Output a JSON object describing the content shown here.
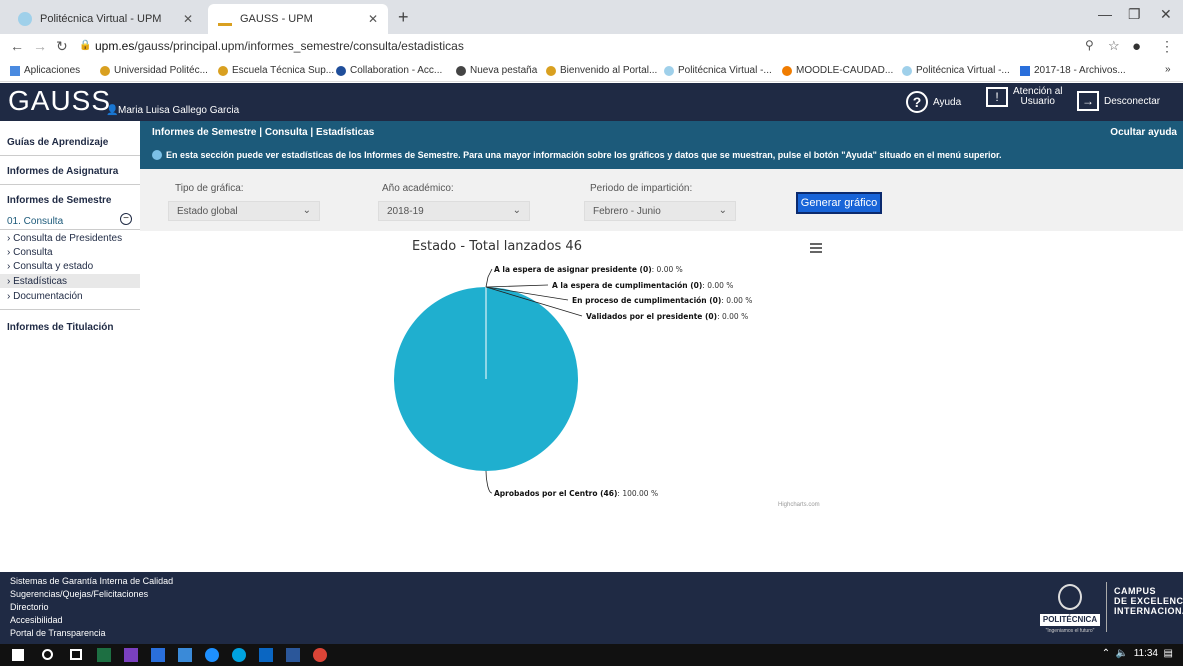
{
  "browser": {
    "tabs": [
      {
        "title": "Politécnica Virtual - UPM",
        "active": false
      },
      {
        "title": "GAUSS - UPM",
        "active": true
      }
    ],
    "new_tab": "+",
    "url_domain": "upm.es",
    "url_path": "/gauss/principal.upm/informes_semestre/consulta/estadisticas",
    "bookmarks": [
      "Aplicaciones",
      "Universidad Politéc...",
      "Escuela Técnica Sup...",
      "Collaboration - Acc...",
      "Nueva pestaña",
      "Bienvenido al Portal...",
      "Politécnica Virtual -...",
      "MOODLE-CAUDAD...",
      "Politécnica Virtual -...",
      "2017-18 - Archivos..."
    ],
    "bookmark_more": "»"
  },
  "header": {
    "logo": "GAUSS",
    "user": "Maria Luisa Gallego Garcia",
    "help": "Ayuda",
    "attention_line1": "Atención al",
    "attention_line2": "Usuario",
    "logout": "Desconectar"
  },
  "sidebar": {
    "guias": "Guías de Aprendizaje",
    "asignatura": "Informes de Asignatura",
    "semestre": "Informes de Semestre",
    "consulta_group": "01. Consulta",
    "items": [
      "Consulta de Presidentes",
      "Consulta",
      "Consulta y estado",
      "Estadísticas",
      "Documentación"
    ],
    "titulacion": "Informes de Titulación"
  },
  "info": {
    "title": "Informes de Semestre | Consulta | Estadísticas",
    "hide_help": "Ocultar ayuda",
    "message": "En esta sección puede ver estadísticas de los Informes de Semestre. Para una mayor información sobre los gráficos y datos que se muestran, pulse el botón \"Ayuda\" situado en el menú superior."
  },
  "filters": {
    "tipo_label": "Tipo de gráfica:",
    "tipo_value": "Estado global",
    "anio_label": "Año académico:",
    "anio_value": "2018-19",
    "periodo_label": "Periodo de impartición:",
    "periodo_value": "Febrero - Junio",
    "button": "Generar gráfico"
  },
  "chart_data": {
    "type": "pie",
    "title": "Estado - Total lanzados 46",
    "credit": "Highcharts.com",
    "color": "#1fafcf",
    "slices": [
      {
        "label": "A la espera de asignar presidente",
        "count": 0,
        "percent": "0.00 %"
      },
      {
        "label": "A la espera de cumplimentación",
        "count": 0,
        "percent": "0.00 %"
      },
      {
        "label": "En proceso de cumplimentación",
        "count": 0,
        "percent": "0.00 %"
      },
      {
        "label": "Validados por el presidente",
        "count": 0,
        "percent": "0.00 %"
      },
      {
        "label": "Aprobados por el Centro",
        "count": 46,
        "percent": "100.00 %"
      }
    ]
  },
  "footer": {
    "links": [
      "Sistemas de Garantía Interna de Calidad",
      "Sugerencias/Quejas/Felicitaciones",
      "Directorio",
      "Accesibilidad",
      "Portal de Transparencia"
    ],
    "politecnica": "POLITÉCNICA",
    "tagline": "\"Ingeniamos el futuro\"",
    "campus1": "CAMPUS",
    "campus2": "DE EXCELENCIA",
    "campus3": "INTERNACIONAL"
  },
  "taskbar": {
    "time": "11:34"
  }
}
